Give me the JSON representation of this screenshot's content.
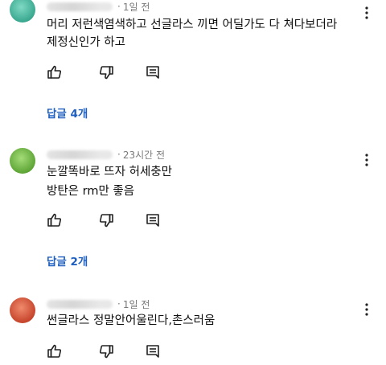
{
  "comments": [
    {
      "time": "1일 전",
      "text_lines": [
        "머리 저런색염색하고 선글라스 끼면 어딜가도 다 쳐다보더라",
        "제정신인가 하고"
      ],
      "replies_label": "답글 4개",
      "avatar_color": "#4fbfa8"
    },
    {
      "time": "23시간 전",
      "text_lines": [
        "눈깔똑바로 뜨자 허세충만",
        "방탄은 rm만 좋음"
      ],
      "replies_label": "답글 2개",
      "avatar_color": "#7cc24a"
    },
    {
      "time": "1일 전",
      "text_lines": [
        "썬글라스 정말안어울린다,촌스러움"
      ],
      "replies_label": "",
      "avatar_color": "#d9533a"
    }
  ],
  "icons": {
    "like": "thumbs-up-icon",
    "dislike": "thumbs-down-icon",
    "reply": "comment-icon",
    "more": "more-vert-icon"
  },
  "colors": {
    "replies_link": "#1f5fbf",
    "meta_text": "#7a7a7a"
  }
}
